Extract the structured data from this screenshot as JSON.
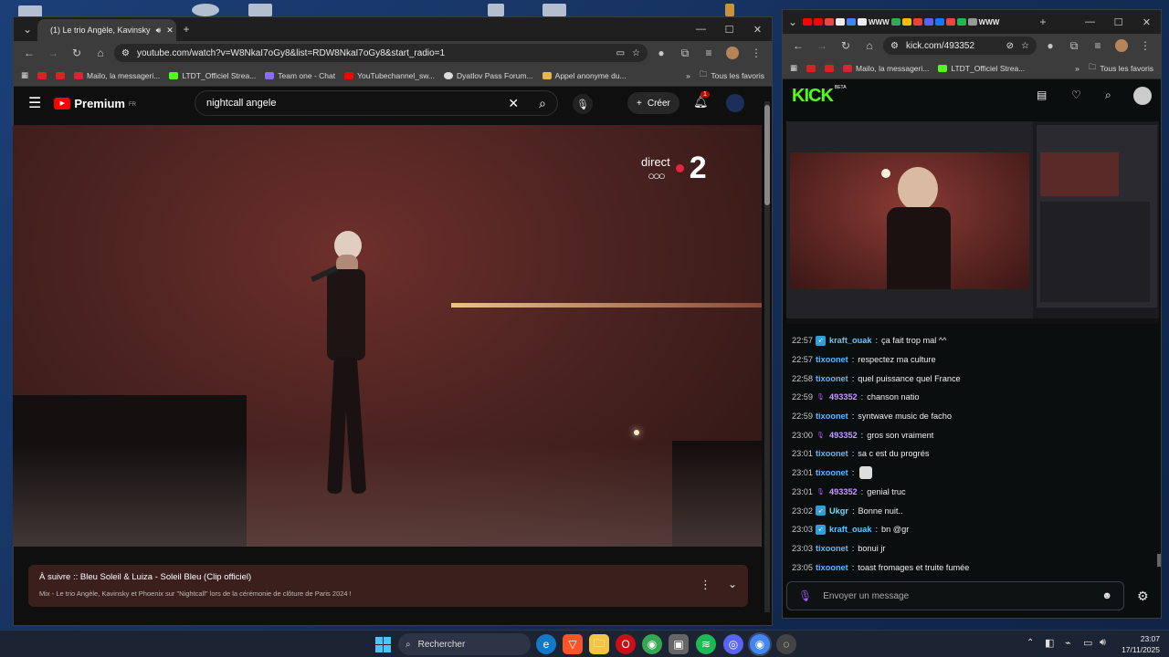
{
  "left_browser": {
    "tab_title": "(1) Le trio Angèle, Kavinsky",
    "url": "youtube.com/watch?v=W8NkaI7oGy8&list=RDW8NkaI7oGy8&start_radio=1",
    "bookmarks": [
      "Mailo, la messageri...",
      "LTDT_Officiel Strea...",
      "Team one - Chat",
      "YouTubechannel_sw...",
      "Dyatlov Pass Forum...",
      "Appel anonyme du..."
    ],
    "all_favorites": "Tous les favoris"
  },
  "youtube": {
    "logo": "Premium",
    "country": "FR",
    "search_value": "nightcall angele",
    "create_label": "Créer",
    "notification_count": "1",
    "overlay_direct": "direct",
    "overlay_channel": "2",
    "next_title": "À suivre :: Bleu Soleil & Luiza - Soleil Bleu (Clip officiel)",
    "next_desc": "Mix - Le trio Angèle, Kavinsky et Phoenix sur \"Nightcall\" lors de la cérémonie de clôture de Paris 2024 !"
  },
  "right_browser": {
    "url": "kick.com/493352",
    "bookmarks": [
      "Mailo, la messageri...",
      "LTDT_Officiel Strea..."
    ],
    "all_favorites": "Tous les favoris",
    "tab_strip_text": "WWW"
  },
  "kick": {
    "logo": "KICK",
    "beta": "BETA",
    "chat_placeholder": "Envoyer un message",
    "chat": [
      {
        "time": "22:57",
        "user": "kraft_ouak",
        "color": "#5ec8ff",
        "badge": "mod",
        "msg": "ça fait trop mal ^^"
      },
      {
        "time": "22:57",
        "user": "tixoonet",
        "color": "#5eb6ff",
        "badge": "",
        "msg": "respectez ma culture"
      },
      {
        "time": "22:58",
        "user": "tixoonet",
        "color": "#5eb6ff",
        "badge": "",
        "msg": "quel puissance quel France"
      },
      {
        "time": "22:59",
        "user": "493352",
        "color": "#c59bff",
        "badge": "mic",
        "msg": "chanson natio"
      },
      {
        "time": "22:59",
        "user": "tixoonet",
        "color": "#5eb6ff",
        "badge": "",
        "msg": "syntwave music de facho"
      },
      {
        "time": "23:00",
        "user": "493352",
        "color": "#c59bff",
        "badge": "mic",
        "msg": "gros son vraiment"
      },
      {
        "time": "23:01",
        "user": "tixoonet",
        "color": "#5eb6ff",
        "badge": "",
        "msg": "sa c est du progrés"
      },
      {
        "time": "23:01",
        "user": "tixoonet",
        "color": "#5eb6ff",
        "badge": "",
        "msg": ""
      },
      {
        "time": "23:01",
        "user": "493352",
        "color": "#c59bff",
        "badge": "mic",
        "msg": "genial truc"
      },
      {
        "time": "23:02",
        "user": "Ukgr",
        "color": "#7dd3fc",
        "badge": "mod",
        "msg": "Bonne nuit.."
      },
      {
        "time": "23:03",
        "user": "kraft_ouak",
        "color": "#5ec8ff",
        "badge": "mod",
        "msg": "bn @gr"
      },
      {
        "time": "23:03",
        "user": "tixoonet",
        "color": "#5eb6ff",
        "badge": "",
        "msg": "bonui jr"
      },
      {
        "time": "23:05",
        "user": "tixoonet",
        "color": "#5eb6ff",
        "badge": "",
        "msg": "toast fromages et truite fumée"
      }
    ]
  },
  "taskbar": {
    "search_label": "Rechercher",
    "time": "23:07",
    "date": "17/11/2025"
  },
  "colors": {
    "youtube_red": "#ff0000",
    "kick_green": "#53fc18",
    "mic_purple": "#a855f7"
  }
}
